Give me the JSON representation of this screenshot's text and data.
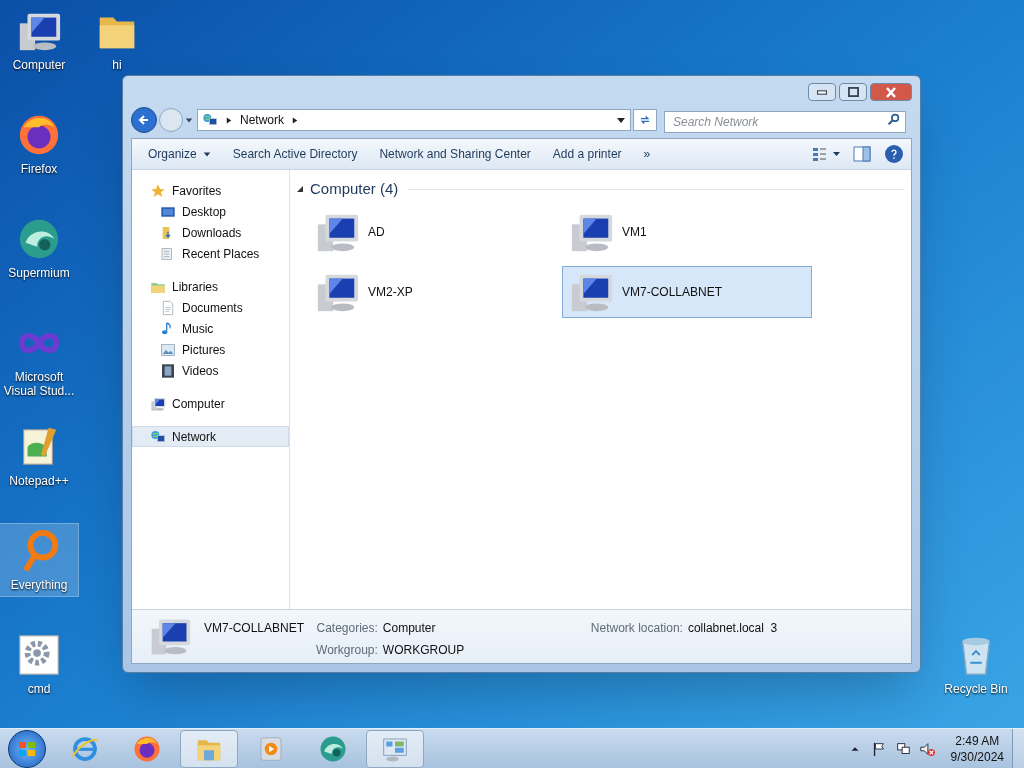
{
  "desktop_icons": [
    {
      "label": "Computer",
      "kind": "computer",
      "selected": false
    },
    {
      "label": "hi",
      "kind": "folder",
      "selected": false
    },
    {
      "label": "Firefox",
      "kind": "firefox",
      "selected": false
    },
    {
      "label": "Supermium",
      "kind": "supermium",
      "selected": false
    },
    {
      "label": "Microsoft Visual Stud...",
      "kind": "vs",
      "selected": false
    },
    {
      "label": "Notepad++",
      "kind": "notepad",
      "selected": false
    },
    {
      "label": "Everything",
      "kind": "everything",
      "selected": true
    },
    {
      "label": "cmd",
      "kind": "cmd",
      "selected": false
    },
    {
      "label": "Recycle Bin",
      "kind": "recycle",
      "selected": false
    }
  ],
  "window": {
    "address": {
      "crumbs": [
        "Network"
      ]
    },
    "search": {
      "placeholder": "Search Network"
    },
    "toolbar": [
      {
        "label": "Organize",
        "dropdown": true
      },
      {
        "label": "Search Active Directory",
        "dropdown": false
      },
      {
        "label": "Network and Sharing Center",
        "dropdown": false
      },
      {
        "label": "Add a printer",
        "dropdown": false
      },
      {
        "label": "»",
        "dropdown": false
      }
    ],
    "nav_pane": [
      {
        "label": "Favorites",
        "kind": "star",
        "selected": false,
        "children": [
          {
            "label": "Desktop",
            "kind": "desktop",
            "selected": false
          },
          {
            "label": "Downloads",
            "kind": "downloads",
            "selected": false
          },
          {
            "label": "Recent Places",
            "kind": "recent",
            "selected": false
          }
        ]
      },
      {
        "label": "Libraries",
        "kind": "libraries",
        "selected": false,
        "children": [
          {
            "label": "Documents",
            "kind": "documents",
            "selected": false
          },
          {
            "label": "Music",
            "kind": "music",
            "selected": false
          },
          {
            "label": "Pictures",
            "kind": "pictures",
            "selected": false
          },
          {
            "label": "Videos",
            "kind": "videos",
            "selected": false
          }
        ]
      },
      {
        "label": "Computer",
        "kind": "computer",
        "selected": false
      },
      {
        "label": "Network",
        "kind": "network",
        "selected": true
      }
    ],
    "content": {
      "group": {
        "title": "Computer (4)",
        "expanded": true
      },
      "items": [
        {
          "name": "AD",
          "selected": false
        },
        {
          "name": "VM1",
          "selected": false
        },
        {
          "name": "VM2-XP",
          "selected": false
        },
        {
          "name": "VM7-COLLABNET",
          "selected": true
        }
      ]
    },
    "details": {
      "name": "VM7-COLLABNET",
      "fields": [
        {
          "label": "Categories:",
          "value": "Computer"
        },
        {
          "label": "Workgroup:",
          "value": "WORKGROUP"
        },
        {
          "label": "Network location:",
          "value": "collabnet.local  3"
        }
      ]
    }
  },
  "taskbar": {
    "apps": [
      {
        "kind": "ie",
        "open": false
      },
      {
        "kind": "firefox",
        "open": false
      },
      {
        "kind": "explorer",
        "open": true
      },
      {
        "kind": "media",
        "open": false
      },
      {
        "kind": "supermium",
        "open": false
      },
      {
        "kind": "controlpanel",
        "open": true
      }
    ],
    "clock": {
      "time": "2:49 AM",
      "date": "9/30/2024"
    }
  }
}
